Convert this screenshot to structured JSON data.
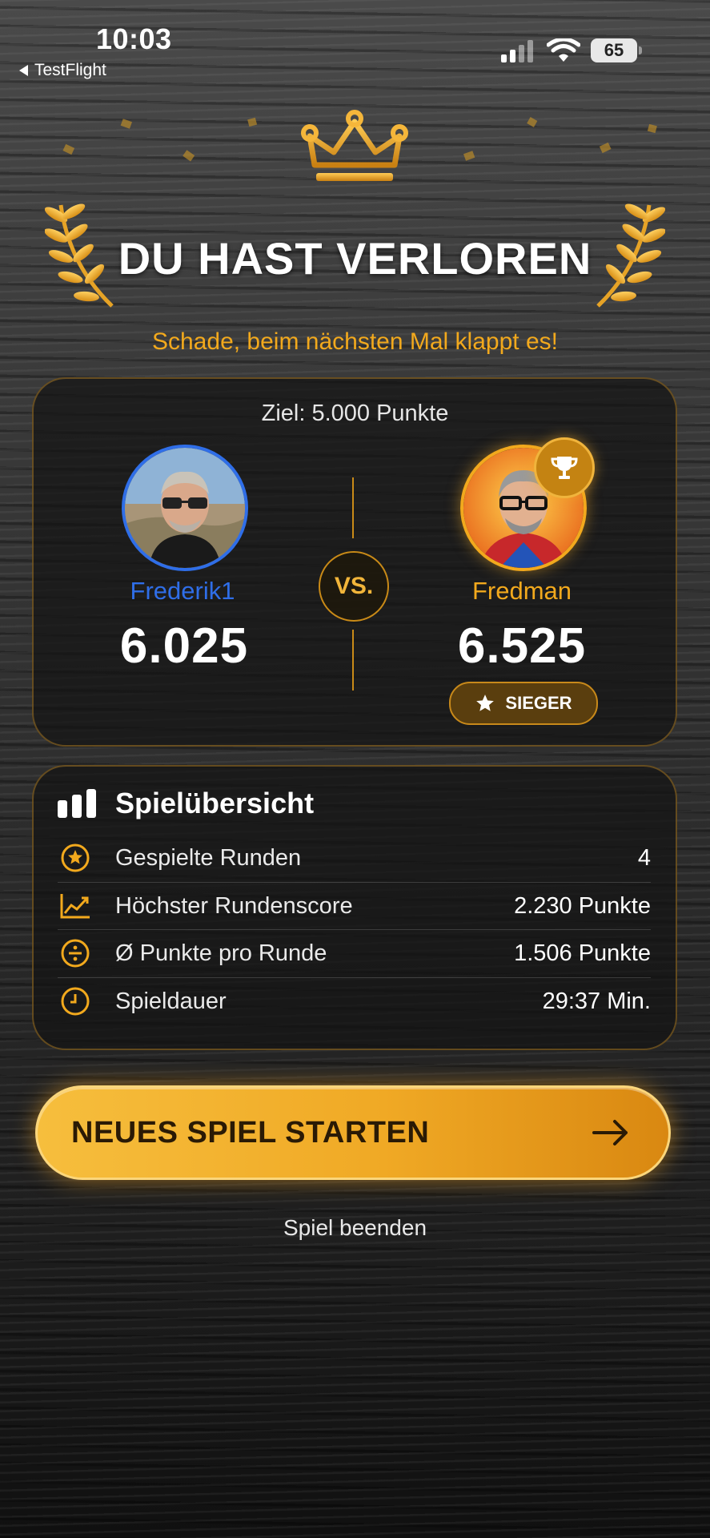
{
  "status_bar": {
    "time": "10:03",
    "back_app": "TestFlight",
    "battery": "65"
  },
  "result": {
    "title": "DU HAST VERLOREN",
    "subtitle": "Schade, beim nächsten Mal klappt es!"
  },
  "match": {
    "goal": "Ziel: 5.000 Punkte",
    "vs_label": "VS.",
    "player1": {
      "name": "Frederik1",
      "score": "6.025",
      "accent": "#2f6ee8"
    },
    "player2": {
      "name": "Fredman",
      "score": "6.525",
      "accent": "#f2a91d",
      "badge": "SIEGER"
    }
  },
  "summary": {
    "title": "Spielübersicht",
    "rows": [
      {
        "icon": "star-circle-icon",
        "label": "Gespielte Runden",
        "value": "4"
      },
      {
        "icon": "trend-chart-icon",
        "label": "Höchster Rundenscore",
        "value": "2.230 Punkte"
      },
      {
        "icon": "divide-icon",
        "label": "Ø Punkte pro Runde",
        "value": "1.506 Punkte"
      },
      {
        "icon": "clock-icon",
        "label": "Spieldauer",
        "value": "29:37 Min."
      }
    ]
  },
  "actions": {
    "primary": "NEUES SPIEL STARTEN",
    "secondary": "Spiel beenden"
  },
  "colors": {
    "gold": "#f2a91d",
    "blue": "#2f6ee8",
    "card_border": "#c98a17"
  }
}
